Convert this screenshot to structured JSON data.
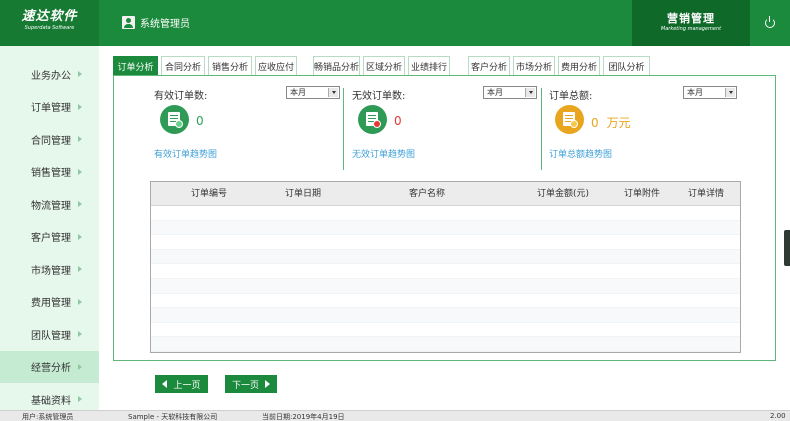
{
  "header": {
    "logo_main": "速达软件",
    "logo_sub": "Superdata Software",
    "user_name": "系统管理员",
    "module_main": "营销管理",
    "module_sub": "Marketing management"
  },
  "sidebar": {
    "items": [
      {
        "label": "业务办公"
      },
      {
        "label": "订单管理"
      },
      {
        "label": "合同管理"
      },
      {
        "label": "销售管理"
      },
      {
        "label": "物流管理"
      },
      {
        "label": "客户管理"
      },
      {
        "label": "市场管理"
      },
      {
        "label": "费用管理"
      },
      {
        "label": "团队管理"
      },
      {
        "label": "经营分析"
      },
      {
        "label": "基础资料"
      }
    ],
    "active": "经营分析"
  },
  "tabs": [
    {
      "label": "订单分析",
      "active": true
    },
    {
      "label": "合同分析"
    },
    {
      "label": "销售分析"
    },
    {
      "label": "应收应付"
    },
    {
      "label": "畅销品分析"
    },
    {
      "label": "区域分析"
    },
    {
      "label": "业绩排行"
    },
    {
      "label": "客户分析"
    },
    {
      "label": "市场分析"
    },
    {
      "label": "费用分析"
    },
    {
      "label": "团队分析"
    }
  ],
  "stats": {
    "valid": {
      "label": "有效订单数:",
      "period": "本月",
      "value": "0",
      "link": "有效订单趋势图"
    },
    "invalid": {
      "label": "无效订单数:",
      "period": "本月",
      "value": "0",
      "link": "无效订单趋势图"
    },
    "total": {
      "label": "订单总额:",
      "period": "本月",
      "value": "0",
      "unit": "万元",
      "link": "订单总额趋势图"
    }
  },
  "table": {
    "columns": [
      "订单编号",
      "订单日期",
      "客户名称",
      "订单金额(元)",
      "订单附件",
      "订单详情"
    ],
    "rows": []
  },
  "pager": {
    "prev": "上一页",
    "next": "下一页"
  },
  "statusbar": {
    "user": "用户:系统管理员",
    "company": "Sample - 天软科技有限公司",
    "date": "当前日期:2019年4月19日",
    "version": "2.00"
  },
  "colors": {
    "brand": "#1b8a3c",
    "link": "#3fa0d8",
    "invalid": "#e53935",
    "total": "#e8a51d"
  }
}
